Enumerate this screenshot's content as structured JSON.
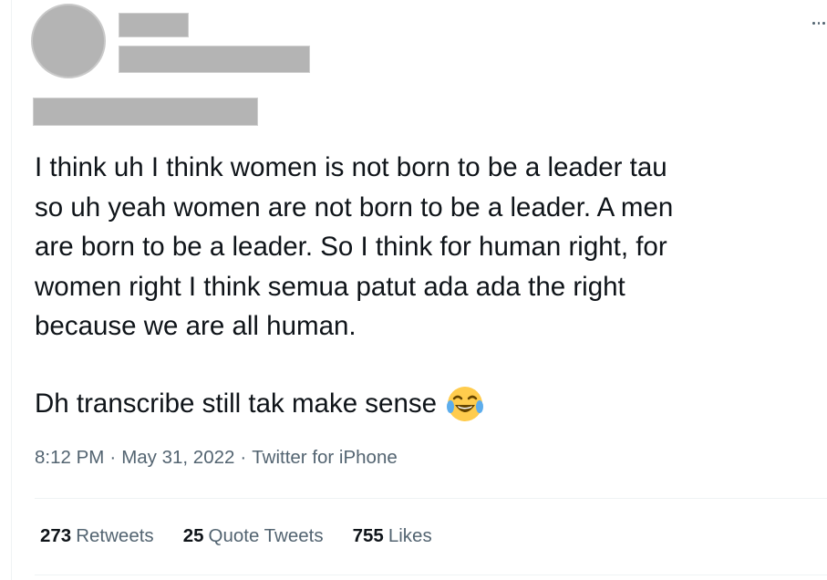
{
  "tweet": {
    "body": "I think uh I think women is not born to be a leader tau\nso uh yeah women are not born to be a leader. A men\nare born to be a leader. So I think for human right, for\nwomen right I think semua patut ada ada the right\nbecause we are all human.",
    "body2": "Dh transcribe still tak make sense",
    "emoji": "face-with-tears-of-joy-icon",
    "time": "8:12 PM",
    "separator": "·",
    "date": "May 31, 2022",
    "source": "Twitter for iPhone"
  },
  "stats": {
    "retweets_count": "273",
    "retweets_label": "Retweets",
    "quotes_count": "25",
    "quotes_label": "Quote Tweets",
    "likes_count": "755",
    "likes_label": "Likes"
  },
  "colors": {
    "text": "#0f1419",
    "secondary": "#536471",
    "redaction": "#b4b4b4",
    "divider": "#eff3f4"
  }
}
